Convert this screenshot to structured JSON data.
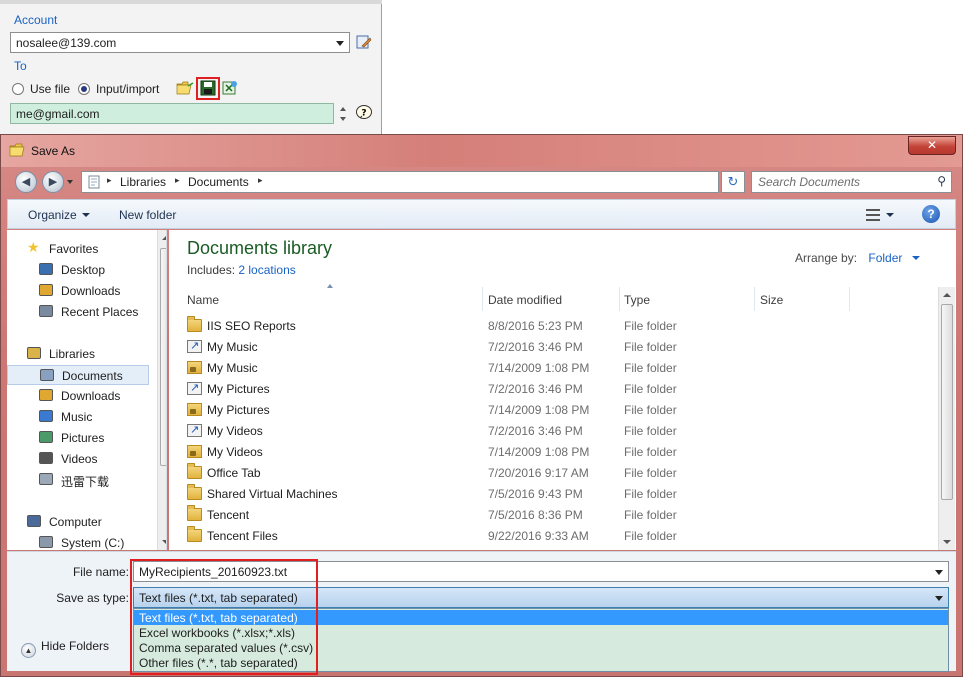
{
  "background_panel": {
    "account_label": "Account",
    "account_value": "nosalee@139.com",
    "to_label": "To",
    "use_file_label": "Use file",
    "input_import_label": "Input/import",
    "recipient_value": "me@gmail.com"
  },
  "dialog": {
    "title": "Save As",
    "close_symbol": "✕",
    "address": {
      "crumbs": [
        "Libraries",
        "Documents"
      ],
      "separator": "▸"
    },
    "search_placeholder": "Search Documents",
    "toolbar": {
      "organize_label": "Organize",
      "new_folder_label": "New folder",
      "help_symbol": "?"
    },
    "nav": {
      "items": [
        {
          "label": "Favorites",
          "icon": "star-icon",
          "level": 0
        },
        {
          "label": "Desktop",
          "icon": "desktop-icon",
          "level": 1
        },
        {
          "label": "Downloads",
          "icon": "downloads-icon",
          "level": 1
        },
        {
          "label": "Recent Places",
          "icon": "recent-places-icon",
          "level": 1
        },
        {
          "label": "Libraries",
          "icon": "libraries-icon",
          "level": 0
        },
        {
          "label": "Documents",
          "icon": "documents-icon",
          "level": 1,
          "selected": true
        },
        {
          "label": "Downloads",
          "icon": "downloads-icon",
          "level": 1
        },
        {
          "label": "Music",
          "icon": "music-icon",
          "level": 1
        },
        {
          "label": "Pictures",
          "icon": "pictures-icon",
          "level": 1
        },
        {
          "label": "Videos",
          "icon": "videos-icon",
          "level": 1
        },
        {
          "label": "迅雷下载",
          "icon": "folder-icon",
          "level": 1
        },
        {
          "label": "Computer",
          "icon": "computer-icon",
          "level": 0
        },
        {
          "label": "System (C:)",
          "icon": "drive-icon",
          "level": 1
        }
      ]
    },
    "library": {
      "title": "Documents library",
      "includes_label": "Includes:",
      "includes_link": "2 locations",
      "arrange_label": "Arrange by:",
      "arrange_value": "Folder"
    },
    "columns": [
      "Name",
      "Date modified",
      "Type",
      "Size"
    ],
    "files": [
      {
        "name": "IIS SEO Reports",
        "date": "8/8/2016 5:23 PM",
        "type": "File folder",
        "icon": "folder"
      },
      {
        "name": "My Music",
        "date": "7/2/2016 3:46 PM",
        "type": "File folder",
        "icon": "shortcut"
      },
      {
        "name": "My Music",
        "date": "7/14/2009 1:08 PM",
        "type": "File folder",
        "icon": "lockfolder"
      },
      {
        "name": "My Pictures",
        "date": "7/2/2016 3:46 PM",
        "type": "File folder",
        "icon": "shortcut"
      },
      {
        "name": "My Pictures",
        "date": "7/14/2009 1:08 PM",
        "type": "File folder",
        "icon": "lockfolder"
      },
      {
        "name": "My Videos",
        "date": "7/2/2016 3:46 PM",
        "type": "File folder",
        "icon": "shortcut"
      },
      {
        "name": "My Videos",
        "date": "7/14/2009 1:08 PM",
        "type": "File folder",
        "icon": "lockfolder"
      },
      {
        "name": "Office Tab",
        "date": "7/20/2016 9:17 AM",
        "type": "File folder",
        "icon": "folder"
      },
      {
        "name": "Shared Virtual Machines",
        "date": "7/5/2016 9:43 PM",
        "type": "File folder",
        "icon": "folder"
      },
      {
        "name": "Tencent",
        "date": "7/5/2016 8:36 PM",
        "type": "File folder",
        "icon": "folder"
      },
      {
        "name": "Tencent Files",
        "date": "9/22/2016 9:33 AM",
        "type": "File folder",
        "icon": "folder"
      }
    ],
    "form": {
      "file_name_label": "File name:",
      "file_name_value": "MyRecipients_20160923.txt",
      "save_as_type_label": "Save as type:",
      "save_as_type_value": "Text files (*.txt, tab separated)",
      "type_options": [
        "Text files (*.txt, tab separated)",
        "Excel workbooks (*.xlsx;*.xls)",
        "Comma separated values (*.csv)",
        "Other files (*.*, tab separated)"
      ],
      "selected_option_index": 0,
      "hide_folders_label": "Hide Folders"
    }
  },
  "colors": {
    "link_blue": "#1a62c4",
    "library_title_green": "#1a5c24",
    "highlight_red": "#e02020",
    "selection_blue": "#3399ff",
    "dropdown_green": "#d6ebde"
  }
}
